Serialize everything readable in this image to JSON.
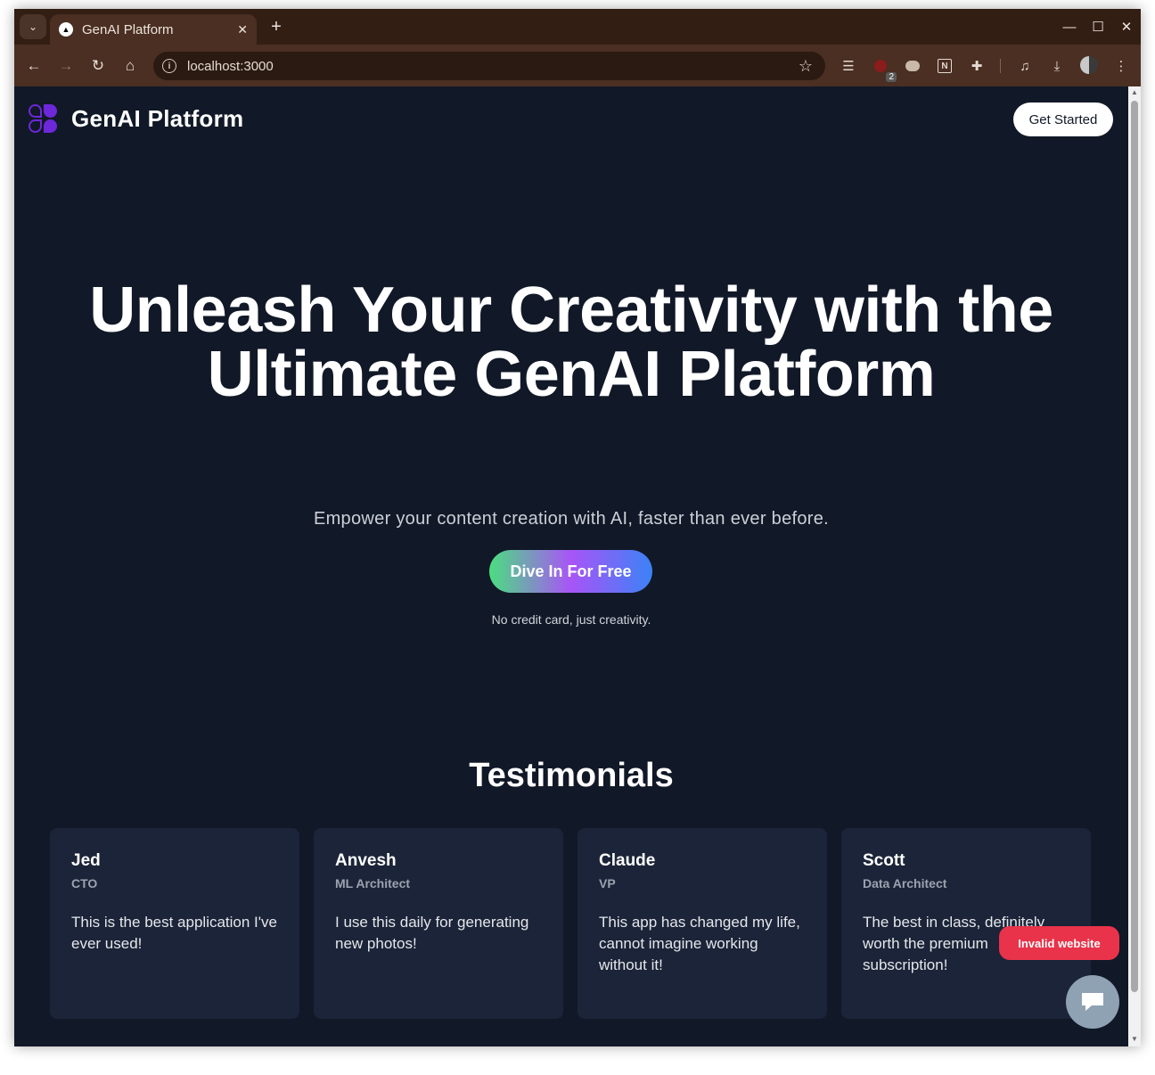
{
  "browser": {
    "tab_title": "GenAI Platform",
    "tab_close": "✕",
    "new_tab": "+",
    "url": "localhost:3000",
    "extension_badge": "2",
    "controls": {
      "minimize": "—",
      "maximize": "☐",
      "close": "✕"
    }
  },
  "header": {
    "brand_name": "GenAI Platform",
    "get_started_label": "Get Started"
  },
  "hero": {
    "heading_line1": "Unleash Your Creativity with the",
    "heading_line2": "Ultimate GenAI Platform",
    "subtitle": "Empower your content creation with AI, faster than ever before.",
    "cta_label": "Dive In For Free",
    "note": "No credit card, just creativity."
  },
  "testimonials": {
    "title": "Testimonials",
    "items": [
      {
        "name": "Jed",
        "role": "CTO",
        "quote": "This is the best application I've ever used!"
      },
      {
        "name": "Anvesh",
        "role": "ML Architect",
        "quote": "I use this daily for generating new photos!"
      },
      {
        "name": "Claude",
        "role": "VP",
        "quote": "This app has changed my life, cannot imagine working without it!"
      },
      {
        "name": "Scott",
        "role": "Data Architect",
        "quote": "The best in class, definitely worth the premium subscription!"
      }
    ]
  },
  "overlay": {
    "invalid_label": "Invalid website"
  },
  "colors": {
    "page_bg": "#111827",
    "card_bg": "#1b2438",
    "cta_gradient": [
      "#4ade80",
      "#a855f7",
      "#3b82f6"
    ],
    "logo_purple": "#6d28d9",
    "invalid_badge": "#e8334a"
  }
}
